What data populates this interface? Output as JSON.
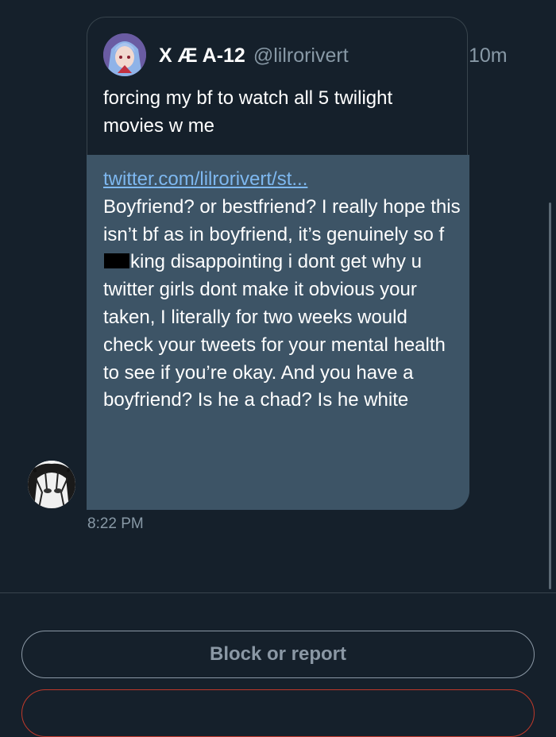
{
  "quoted_tweet": {
    "display_name": "X Æ A-12",
    "handle": "@lilrorivert",
    "time_ago": "10m",
    "text": "forcing my bf to watch all 5 twilight movies w me"
  },
  "message": {
    "link": "twitter.com/lilrorivert/st...",
    "text_before_redaction": "Boyfriend? or bestfriend? I really hope this isn’t bf as in boyfriend, it’s genuinely so f",
    "text_after_redaction": "king disappointing i dont get why u twitter girls dont make it obvious your taken, I literally for two weeks would check your tweets for your mental health to see if you’re okay. And you have a boyfriend? Is he a chad? Is he white",
    "timestamp": "8:22 PM"
  },
  "footer": {
    "block_label": "Block or report"
  },
  "colors": {
    "background": "#15202b",
    "bubble": "#3d5466",
    "link": "#7eb8f0",
    "muted": "#8899a6"
  }
}
